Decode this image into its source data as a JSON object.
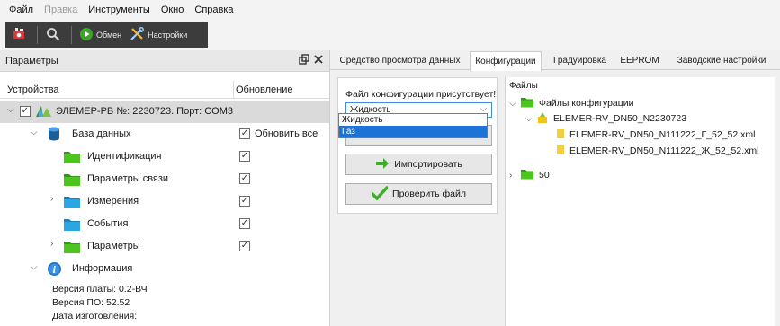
{
  "menu": [
    {
      "label": "Файл",
      "disabled": false
    },
    {
      "label": "Правка",
      "disabled": true
    },
    {
      "label": "Инструменты",
      "disabled": false
    },
    {
      "label": "Окно",
      "disabled": false
    },
    {
      "label": "Справка",
      "disabled": false
    }
  ],
  "toolbar": {
    "connect_label": "Обмен",
    "settings_label": "Настройки"
  },
  "left_panel": {
    "title": "Параметры",
    "col_devices": "Устройства",
    "col_update": "Обновление",
    "device": "ЭЛЕМЕР-РВ №: 2230723. Порт: COM3",
    "database": "База данных",
    "update_all": "Обновить все",
    "items": [
      {
        "label": "Идентификация",
        "checked": true
      },
      {
        "label": "Параметры связи",
        "checked": true
      },
      {
        "label": "Измерения",
        "checked": true
      },
      {
        "label": "События",
        "checked": true
      },
      {
        "label": "Параметры",
        "checked": true
      }
    ],
    "info": "Информация",
    "board_version": "Версия платы: 0.2-ВЧ",
    "fw_version": "Версия ПО: 52.52",
    "mfg_date": "Дата изготовления:"
  },
  "tabs": [
    {
      "label": "Средство просмотра данных",
      "active": false
    },
    {
      "label": "Конфигурации",
      "active": true
    },
    {
      "label": "Градуировка",
      "active": false
    },
    {
      "label": "EEPROM",
      "active": false
    },
    {
      "label": "Заводские настройки",
      "active": false
    }
  ],
  "config": {
    "present_text": "Файл конфигурации присутствует!",
    "selected": "Жидкость",
    "options": [
      "Жидкость",
      "Газ"
    ],
    "import_label": "Импортировать",
    "check_label": "Проверить файл"
  },
  "files": {
    "title": "Файлы",
    "root": "Файлы конфигурации",
    "device_folder": "ELEMER-RV_DN50_N2230723",
    "file1": "ELEMER-RV_DN50_N111222_Г_52_52.xml",
    "file2": "ELEMER-RV_DN50_N111222_Ж_52_52.xml",
    "folder50": "50"
  },
  "colors": {
    "accent": "#1e74d6",
    "folder_green": "#3fbf1c",
    "folder_blue": "#1f9ad6",
    "toolbar_dark": "#3c3c3c"
  }
}
